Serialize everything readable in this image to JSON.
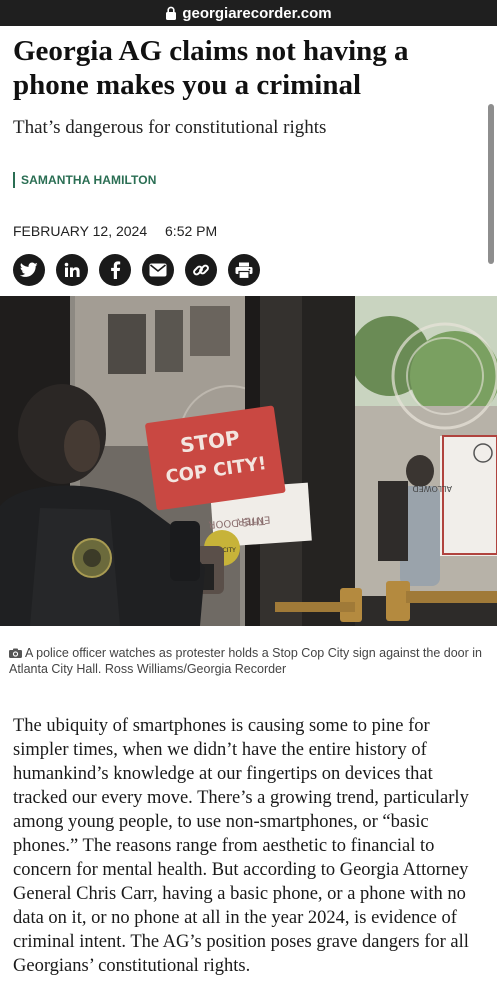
{
  "browser": {
    "url": "georgiarecorder.com"
  },
  "article": {
    "headline": "Georgia AG claims not having a phone makes you a criminal",
    "subhead": "That’s dangerous for constitutional rights",
    "author": "SAMANTHA HAMILTON",
    "date": "FEBRUARY 12, 2024",
    "time": "6:52 PM",
    "share_icons": [
      "twitter-icon",
      "linkedin-icon",
      "facebook-icon",
      "email-icon",
      "link-icon",
      "print-icon"
    ],
    "photo": {
      "sign_line1": "STOP",
      "sign_line2": "COP CITY!",
      "door_text_line1": "ENTER",
      "door_text_line2": "THIS DOOR",
      "notice_text": "ALLOWED",
      "sticker_text": "COP CITY"
    },
    "caption": "A police officer watches as protester holds a Stop Cop City sign against the door in Atlanta City Hall. Ross Williams/Georgia Recorder",
    "body": "The ubiquity of smartphones is causing some to pine for simpler times, when we didn’t have the entire history of humankind’s knowledge at our fingertips on devices that tracked our every move. There’s a growing trend, particularly among young people, to use non-smartphones, or “basic phones.” The reasons range from aesthetic to financial to concern for mental health. But according to Georgia Attorney General Chris Carr, having a basic phone, or a phone with no data on it, or no phone at all in the year 2024, is evidence of criminal intent. The AG’s position poses grave dangers for all Georgians’ constitutional rights."
  },
  "colors": {
    "brand_green": "#2a6e53",
    "urlbar_bg": "#1f1f1f",
    "icon_bg": "#1a1a1a"
  }
}
